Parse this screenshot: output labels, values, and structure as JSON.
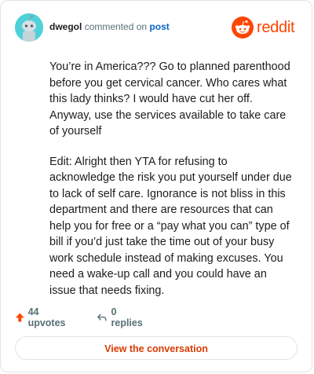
{
  "comment": {
    "username": "dwegol",
    "action_text": "commented on",
    "post_link": "post",
    "paragraphs": [
      "You’re in America??? Go to planned parenthood before you get cervical cancer. Who cares what this lady thinks? I would have cut her off. Anyway, use the services available to take care of yourself",
      "Edit: Alright then YTA for refusing to acknowledge the risk you put yourself under due to lack of self care. Ignorance is not bliss in this department and there are resources that can help you for free or a “pay what you can” type of bill if you’d just take the time out of your busy work schedule instead of making excuses. You need a wake-up call and you could have an issue that needs fixing."
    ]
  },
  "brand": {
    "name": "reddit",
    "color": "#ff4500"
  },
  "stats": {
    "upvotes": "44 upvotes",
    "replies": "0 replies"
  },
  "cta": {
    "label": "View the conversation"
  },
  "icons": {
    "avatar": "snoo-avatar-icon",
    "logo": "reddit-logo-icon",
    "upvote": "upvote-arrow-icon",
    "reply": "reply-arrow-icon"
  }
}
